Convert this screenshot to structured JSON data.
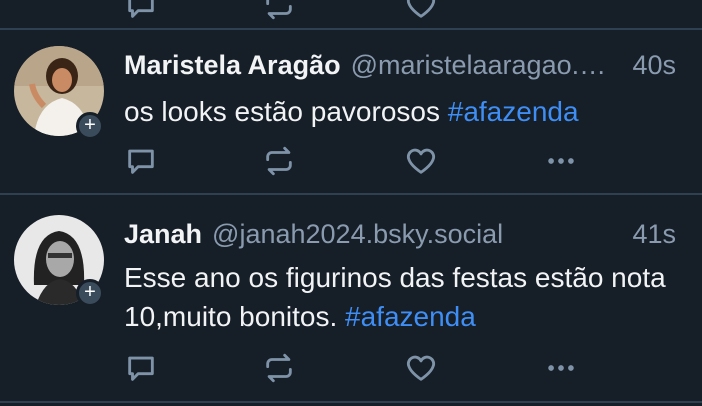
{
  "feed": {
    "posts": [
      {
        "author_name": "Maristela Aragão",
        "author_handle": "@maristelaaragao.bsky.social",
        "time": "40s",
        "text": "os looks estão pavorosos ",
        "hashtag": "#afazenda",
        "follow_badge": "+"
      },
      {
        "author_name": "Janah",
        "author_handle": "@janah2024.bsky.social",
        "time": "41s",
        "text": "Esse ano os figurinos das festas estão nota 10,muito bonitos. ",
        "hashtag": "#afazenda",
        "follow_badge": "+"
      }
    ]
  },
  "colors": {
    "background": "#161e27",
    "divider": "#2e4052",
    "text": "#f1f3f5",
    "secondary_text": "#8a9bb0",
    "hashtag": "#3f8ef5",
    "icon": "#7f93a8"
  },
  "icons": [
    "reply-icon",
    "repost-icon",
    "like-icon",
    "more-icon",
    "plus-icon"
  ]
}
